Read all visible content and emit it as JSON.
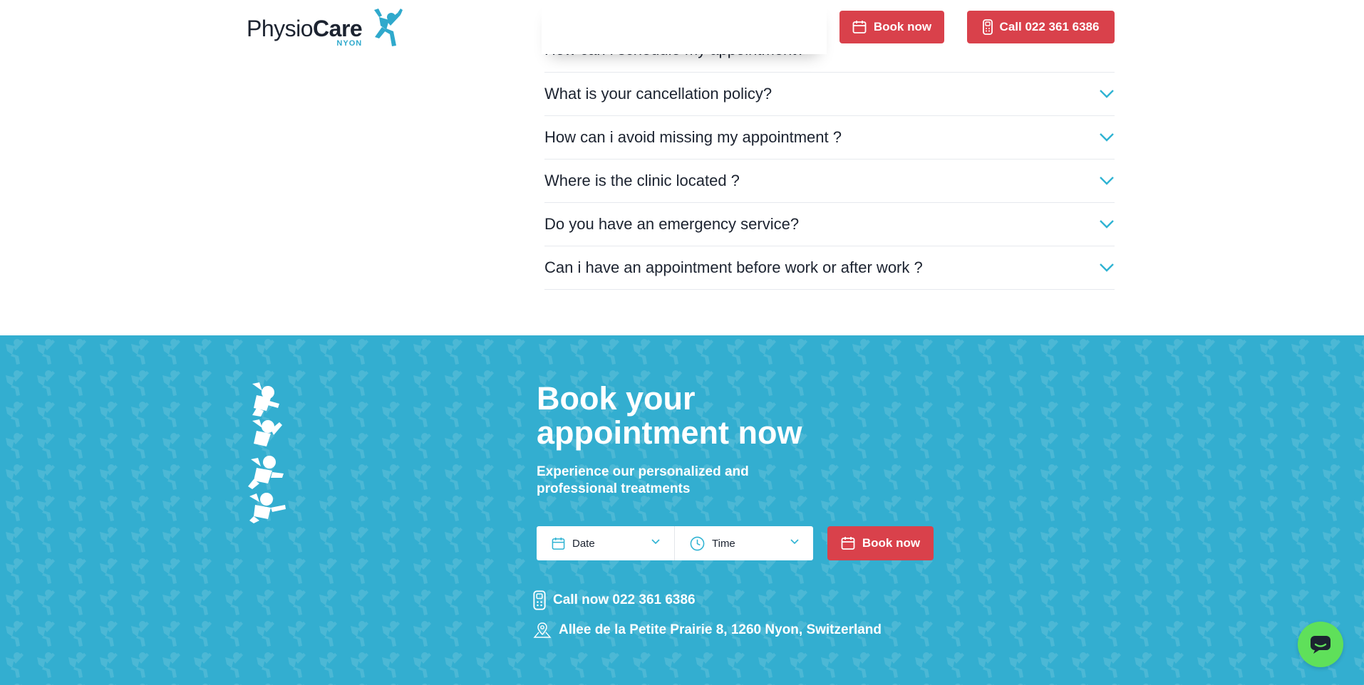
{
  "header": {
    "logo": {
      "physio": "Physio",
      "care": "Care",
      "location": "NYON"
    },
    "book_label": "Book now",
    "call_label": "Call 022 361 6386"
  },
  "faq": {
    "items": [
      {
        "question": "How can i schedule my appointment?"
      },
      {
        "question": "What is your cancellation policy?"
      },
      {
        "question": "How can i avoid missing my appointment ?"
      },
      {
        "question": "Where is the clinic located ?"
      },
      {
        "question": "Do you have an emergency service?"
      },
      {
        "question": "Can i have an appointment before work or after work ?"
      }
    ]
  },
  "booking": {
    "title_line1": "Book your",
    "title_line2": "appointment now",
    "subtitle_line1": "Experience our personalized and",
    "subtitle_line2": "professional treatments",
    "date_placeholder": "Date",
    "time_placeholder": "Time",
    "book_label": "Book now",
    "phone_text": "Call now 022 361 6386",
    "address_text": "Allee de la Petite Prairie 8, 1260 Nyon, Switzerland"
  },
  "colors": {
    "brand_red": "#d9414b",
    "brand_blue": "#33aed0",
    "chat_green": "#5fe05a"
  }
}
